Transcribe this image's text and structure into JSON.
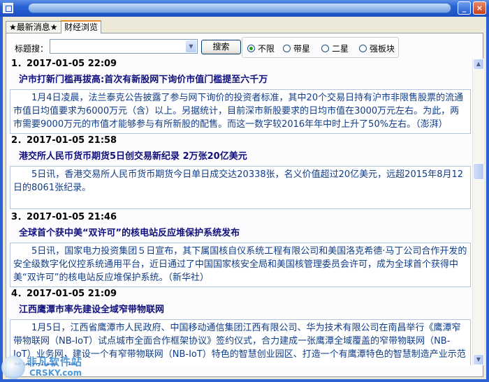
{
  "window": {
    "title": ""
  },
  "tabs": [
    {
      "label": "★最新消息★"
    },
    {
      "label": "财经浏览"
    }
  ],
  "search": {
    "label": "标题搜：",
    "value": "",
    "button": "搜索"
  },
  "filter": {
    "options": [
      "不限",
      "带星",
      "二星",
      "强板块"
    ],
    "selected": "不限"
  },
  "news": [
    {
      "head": "1．2017-01-05 22:09",
      "title": "沪市打新门槛再拔高:首次有新股网下询价市值门槛提至六千万",
      "body": "1月4日凌晨，法兰泰克公告披露了参与网下询价的投资者标准，其中20个交易日持有沪市非限售股票的流通市值日均值要求为6000万元（含）以上。另据统计，目前深市新股要求的日均市值在3000万元左右。为此，两市需要9000万元的市值才能够参与有所新股的配售。而这一数字较2016年年中时上升了50%左右。（澎湃）"
    },
    {
      "head": "2．2017-01-05 21:58",
      "title": "港交所人民币货币期货5日创交易新纪录 2万张20亿美元",
      "body": "5日讯，香港交易所人民币货币期货今日单日成交达20338张，名义价值超过20亿美元，远超2015年8月12日的8061张纪录。"
    },
    {
      "head": "3．2017-01-05 21:46",
      "title": "全球首个获中美“双许可”的核电站反应堆保护系统发布",
      "body": "5日讯，国家电力投资集团５日宣布，其下属国核自仪系统工程有限公司和美国洛克希德·马丁公司合作开发的安全级数字化仪控系统通用平台，近日通过了中国国家核安全局和美国核管理委员会许可，成为全球首个获得中美“双许可”的核电站反应堆保护系统。（新华社）"
    },
    {
      "head": "4．2017-01-05 21:09",
      "title": "江西鹰潭市率先建设全域窄带物联网",
      "body": "1月5日，江西省鹰潭市人民政府、中国移动通信集团江西有限公司、华为技术有限公司在南昌举行《鹰潭窄带物联网（NB-IoT）试点城市全面合作框架协议》签约仪式，合力建成一张鹰潭全域覆盖的窄带物联网（NB-IoT）业务网，建设一个有窄带物联网（NB-IoT）特色的智慧创业园区、打造一个有鹰潭特色的智慧制造产业示范基地和树立一批"
    }
  ],
  "watermark": {
    "text": "非凡软件站",
    "sub": "CRSKY.com"
  }
}
